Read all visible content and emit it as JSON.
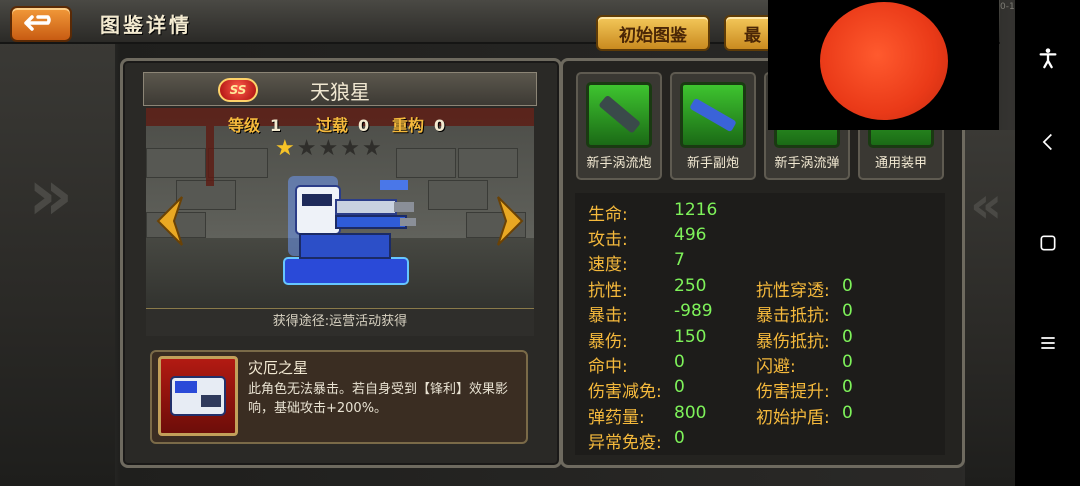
{
  "header": {
    "title": "图鉴详情",
    "initial_button": "初始图鉴",
    "latest_button_partial": "最",
    "version": "0-109-1"
  },
  "unit": {
    "grade_badge": "SS",
    "name": "天狼星",
    "level_label": "等级",
    "level_value": "1",
    "overload_label": "过载",
    "overload_value": "0",
    "rebuild_label": "重构",
    "rebuild_value": "0",
    "stars_filled": 1,
    "stars_total": 5,
    "obtain_text": "获得途径:运营活动获得"
  },
  "skill": {
    "title": "灾厄之星",
    "description": "此角色无法暴击。若自身受到【锋利】效果影响，基础攻击+200%。"
  },
  "equipment": [
    {
      "label": "新手涡流炮"
    },
    {
      "label": "新手副炮"
    },
    {
      "label": "新手涡流弹"
    },
    {
      "label": "通用装甲"
    }
  ],
  "stats_left": [
    {
      "label": "生命:",
      "value": "1216"
    },
    {
      "label": "攻击:",
      "value": "496"
    },
    {
      "label": "速度:",
      "value": "7"
    },
    {
      "label": "抗性:",
      "value": "250"
    },
    {
      "label": "暴击:",
      "value": "-989"
    },
    {
      "label": "暴伤:",
      "value": "150"
    },
    {
      "label": "命中:",
      "value": "0"
    },
    {
      "label": "伤害减免:",
      "value": "0"
    },
    {
      "label": "弹药量:",
      "value": "800"
    },
    {
      "label": "异常免疫:",
      "value": "0"
    }
  ],
  "stats_right": [
    {
      "label": "抗性穿透:",
      "value": "0"
    },
    {
      "label": "暴击抵抗:",
      "value": "0"
    },
    {
      "label": "暴伤抵抗:",
      "value": "0"
    },
    {
      "label": "闪避:",
      "value": "0"
    },
    {
      "label": "伤害提升:",
      "value": "0"
    },
    {
      "label": "初始护盾:",
      "value": "0"
    }
  ],
  "colors": {
    "stat_label": "#f5b93c",
    "stat_value": "#7ef25a",
    "button_orange": "#f29a3a",
    "button_gold": "#f4c85a"
  },
  "system_nav": {
    "icons": [
      "accessibility-icon",
      "back-icon",
      "home-icon",
      "menu-icon"
    ]
  }
}
